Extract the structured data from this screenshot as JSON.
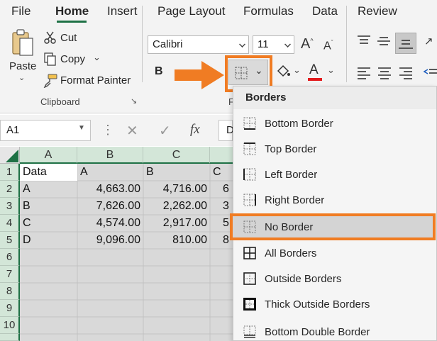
{
  "menu": {
    "tabs": [
      "File",
      "Home",
      "Insert",
      "Page Layout",
      "Formulas",
      "Data",
      "Review"
    ],
    "active": "Home"
  },
  "clipboard": {
    "paste_label": "Paste",
    "cut_label": "Cut",
    "copy_label": "Copy",
    "format_painter_label": "Format Painter",
    "group_label": "Clipboard"
  },
  "font": {
    "name": "Calibri",
    "size": "11",
    "bold_label": "B",
    "group_label_fragment": "F",
    "font_color_label": "A",
    "font_color_accent": "#e31a1c"
  },
  "formula_bar": {
    "name_box": "A1",
    "fx_label": "fx",
    "partial_text": "D"
  },
  "grid": {
    "columns": [
      "A",
      "B",
      "C"
    ],
    "rows": [
      "1",
      "2",
      "3",
      "4",
      "5",
      "6",
      "7",
      "8",
      "9",
      "10"
    ],
    "data": [
      [
        "Data",
        "A",
        "B",
        "C"
      ],
      [
        "A",
        "4,663.00",
        "4,716.00",
        "6"
      ],
      [
        "B",
        "7,626.00",
        "2,262.00",
        "3"
      ],
      [
        "C",
        "4,574.00",
        "2,917.00",
        "5"
      ],
      [
        "D",
        "9,096.00",
        "810.00",
        "8"
      ]
    ]
  },
  "borders_menu": {
    "title": "Borders",
    "items": [
      {
        "label": "Bottom Border",
        "icon": "bottom-border-icon"
      },
      {
        "label": "Top Border",
        "icon": "top-border-icon"
      },
      {
        "label": "Left Border",
        "icon": "left-border-icon"
      },
      {
        "label": "Right Border",
        "icon": "right-border-icon"
      },
      {
        "label": "No Border",
        "icon": "no-border-icon"
      },
      {
        "label": "All Borders",
        "icon": "all-borders-icon"
      },
      {
        "label": "Outside Borders",
        "icon": "outside-borders-icon"
      },
      {
        "label": "Thick Outside Borders",
        "icon": "thick-outside-borders-icon"
      },
      {
        "label": "Bottom Double Border",
        "icon": "bottom-double-border-icon"
      }
    ],
    "highlighted": "No Border"
  },
  "colors": {
    "accent_green": "#1e7145",
    "highlight_orange": "#f07c23"
  }
}
